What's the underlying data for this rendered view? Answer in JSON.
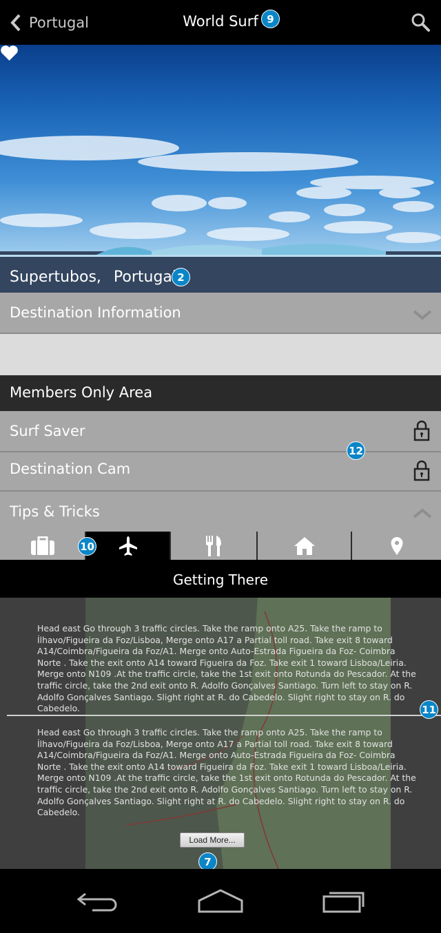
{
  "topbar": {
    "back_label": "Portugal",
    "title": "World Surf",
    "title_badge": "9"
  },
  "hero": {
    "spot": "Supertubos,",
    "country": "Portugal",
    "badge": "2"
  },
  "sections": {
    "destination_info": "Destination Information",
    "members_only": "Members Only Area",
    "surf_saver": "Surf Saver",
    "destination_cam": "Destination Cam",
    "tips_tricks": "Tips & Tricks",
    "lock_badge": "12"
  },
  "tabs": {
    "items": [
      {
        "icon": "briefcase-icon",
        "active": false
      },
      {
        "icon": "airplane-icon",
        "active": true
      },
      {
        "icon": "fork-knife-icon",
        "active": false
      },
      {
        "icon": "home-icon",
        "active": false
      },
      {
        "icon": "location-pin-icon",
        "active": false
      }
    ],
    "badge": "10"
  },
  "getting_there": {
    "title": "Getting There",
    "directions": [
      "Head east Go through 3 traffic circles. Take the ramp onto A25. Take the ramp to Ílhavo/Figueira da Foz/Lisboa, Merge onto A17 a Partial toll road. Take exit 8 toward A14/Coimbra/Figueira da Foz/A1. Merge onto Auto-Estrada Figueira da Foz- Coimbra Norte . Take the exit onto A14 toward Figueira da Foz. Take exit 1 toward Lisboa/Leiria. Merge onto N109 .At the traffic circle, take the 1st exit onto Rotunda do Pescador. At the traffic circle, take the 2nd exit onto R. Adolfo Gonçalves Santiago. Turn left to stay on R. Adolfo Gonçalves Santiago. Slight right at R. do Cabedelo. Slight right to stay on R. do Cabedelo.",
      "Head east Go through 3 traffic circles. Take the ramp onto A25. Take the ramp to Ílhavo/Figueira da Foz/Lisboa, Merge onto A17 a Partial toll road. Take exit 8 toward A14/Coimbra/Figueira da Foz/A1. Merge onto Auto-Estrada Figueira da Foz- Coimbra Norte . Take the exit onto A14 toward Figueira da Foz. Take exit 1 toward Lisboa/Leiria. Merge onto N109 .At the traffic circle, take the 1st exit onto Rotunda do Pescador. At the traffic circle, take the 2nd exit onto R. Adolfo Gonçalves Santiago. Turn left to stay on R. Adolfo Gonçalves Santiago. Slight right at R. do Cabedelo. Slight right to stay on R. do Cabedelo."
    ],
    "divider_badge": "11",
    "load_more": "Load More...",
    "load_more_badge": "7"
  },
  "colors": {
    "accent_badge": "#0a86c8",
    "section_gray": "#a7a7a7",
    "members_bar": "#2a2a2a"
  }
}
